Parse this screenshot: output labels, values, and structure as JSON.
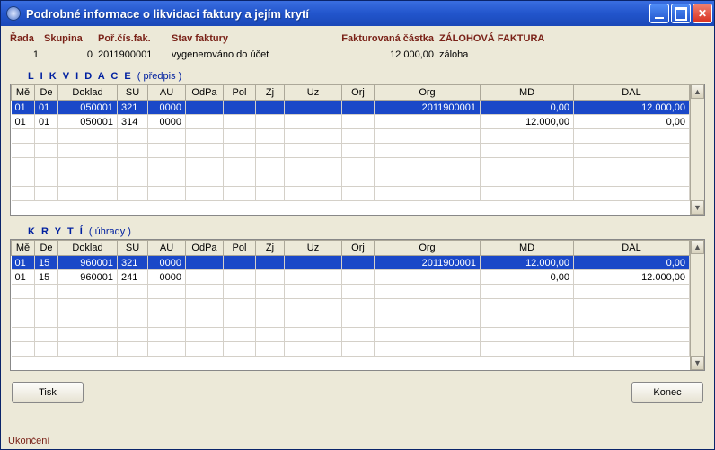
{
  "window": {
    "title": "Podrobné informace o likvidaci faktury a jejím krytí"
  },
  "header": {
    "labels": {
      "rada": "Řada",
      "skupina": "Skupina",
      "por": "Poř.čís.fak.",
      "stav": "Stav faktury",
      "castka": "Fakturovaná částka",
      "zaloha": "ZÁLOHOVÁ FAKTURA"
    },
    "values": {
      "rada": "1",
      "skupina": "0",
      "por": "2011900001",
      "stav": "vygenerováno do účet",
      "castka": "12 000,00",
      "zaloha": "záloha"
    }
  },
  "sections": {
    "likvidace": {
      "title": "L I K V I D A C E",
      "sub": "( předpis )"
    },
    "kryti": {
      "title": "K R  Y T Í",
      "sub": "( úhrady )"
    }
  },
  "columns": {
    "me": "Mě",
    "de": "De",
    "doklad": "Doklad",
    "su": "SU",
    "au": "AU",
    "odpa": "OdPa",
    "pol": "Pol",
    "zj": "Zj",
    "uz": "Uz",
    "orj": "Orj",
    "org": "Org",
    "md": "MD",
    "dal": "DAL"
  },
  "likvidace_rows": [
    {
      "me": "01",
      "de": "01",
      "doklad": "050001",
      "su": "321",
      "au": "0000",
      "odpa": "",
      "pol": "",
      "zj": "",
      "uz": "",
      "orj": "",
      "org": "2011900001",
      "md": "0,00",
      "dal": "12.000,00"
    },
    {
      "me": "01",
      "de": "01",
      "doklad": "050001",
      "su": "314",
      "au": "0000",
      "odpa": "",
      "pol": "",
      "zj": "",
      "uz": "",
      "orj": "",
      "org": "",
      "md": "12.000,00",
      "dal": "0,00"
    }
  ],
  "kryti_rows": [
    {
      "me": "01",
      "de": "15",
      "doklad": "960001",
      "su": "321",
      "au": "0000",
      "odpa": "",
      "pol": "",
      "zj": "",
      "uz": "",
      "orj": "",
      "org": "2011900001",
      "md": "12.000,00",
      "dal": "0,00"
    },
    {
      "me": "01",
      "de": "15",
      "doklad": "960001",
      "su": "241",
      "au": "0000",
      "odpa": "",
      "pol": "",
      "zj": "",
      "uz": "",
      "orj": "",
      "org": "",
      "md": "0,00",
      "dal": "12.000,00"
    }
  ],
  "buttons": {
    "tisk": "Tisk",
    "konec": "Konec"
  },
  "status": "Ukončení"
}
